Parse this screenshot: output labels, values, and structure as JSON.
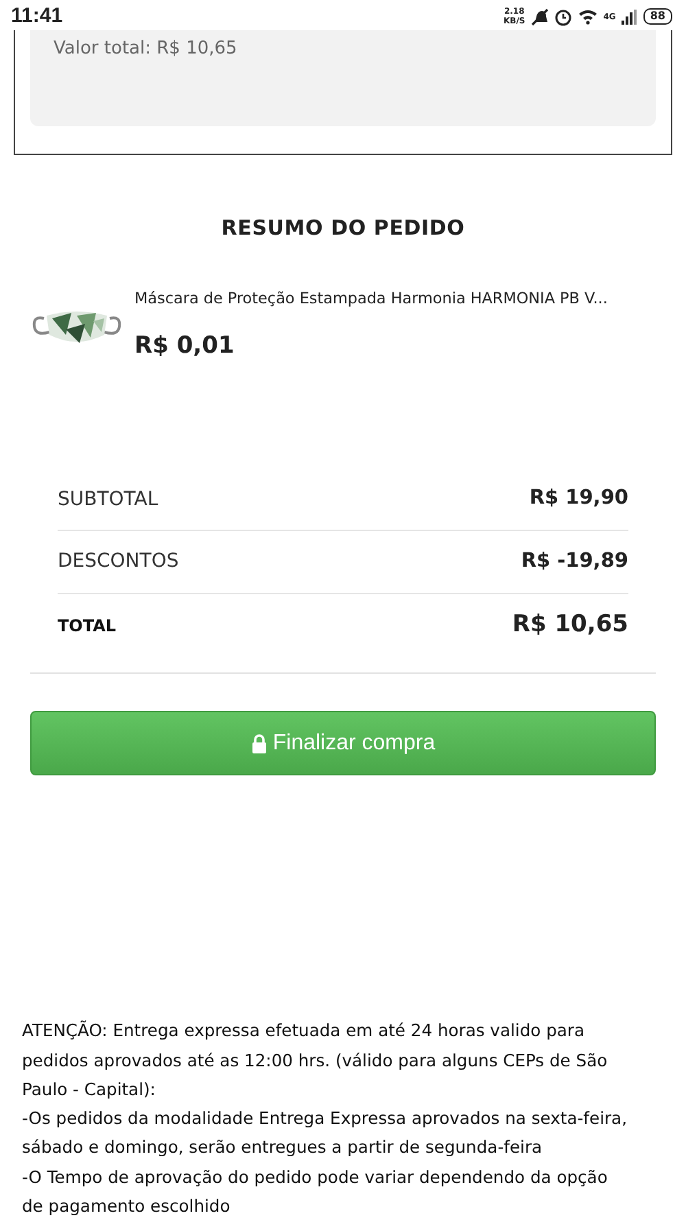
{
  "status_bar": {
    "time": "11:41",
    "speed_value": "2.18",
    "speed_unit": "KB/S",
    "network": "4G",
    "battery": "88"
  },
  "order_total_panel": {
    "text": "Valor total: R$ 10,65"
  },
  "summary": {
    "title": "RESUMO DO PEDIDO",
    "product": {
      "name": "Máscara de Proteção Estampada Harmonia HARMONIA PB V...",
      "price": "R$ 0,01"
    },
    "totals": [
      {
        "label": "SUBTOTAL",
        "value": "R$ 19,90",
        "kind": "normal"
      },
      {
        "label": "DESCONTOS",
        "value": "R$ -19,89",
        "kind": "normal"
      },
      {
        "label": "TOTAL",
        "value": "R$ 10,65",
        "kind": "total"
      }
    ],
    "checkout_button": {
      "label": "Finalizar compra"
    }
  },
  "notice": [
    "ATENÇÃO: Entrega expressa efetuada em até 24 horas valido para pedidos aprovados até as 12:00 hrs. (válido para alguns CEPs de São Paulo - Capital):",
    "-Os pedidos da modalidade Entrega Expressa aprovados na sexta-feira, sábado e domingo, serão entregues a partir de segunda-feira",
    "-O Tempo de aprovação do pedido pode variar dependendo da opção de pagamento escolhido"
  ]
}
